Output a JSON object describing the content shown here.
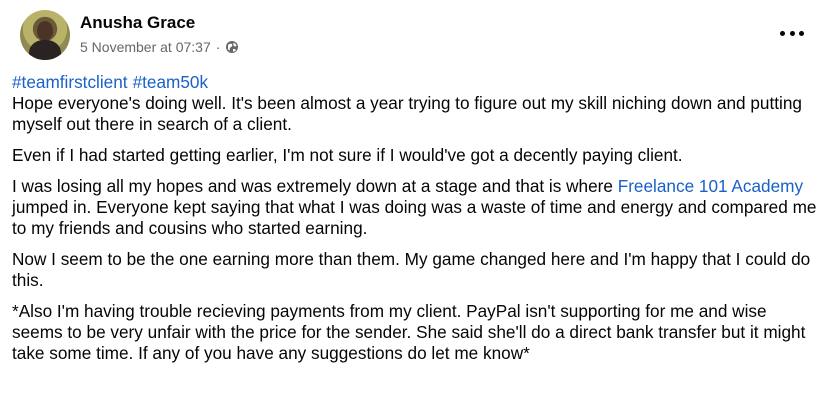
{
  "author": {
    "name": "Anusha Grace",
    "timestamp": "5 November at 07:37",
    "separator": "·",
    "privacy_icon": "globe-icon"
  },
  "menu_icon": "more-options-icon",
  "hashtags": [
    "#teamfirstclient",
    "#team50k"
  ],
  "paragraphs": {
    "p1": "Hope everyone's doing well. It's been almost a year trying to figure out my skill niching down and putting myself out there in search of a client.",
    "p2": "Even if I had started getting earlier, I'm not sure if I would've got a decently paying client.",
    "p3_before": "I was losing all my hopes and was extremely down at a stage and that is where ",
    "p3_link": "Freelance 101 Academy",
    "p3_after": "  jumped in. Everyone kept saying that what I was doing was a waste of time and energy and compared me to my friends and cousins who started earning.",
    "p4": "Now I seem to be the one earning more than them. My game changed here and I'm happy that I could do this.",
    "p5": "*Also I'm having trouble recieving payments from my client. PayPal isn't supporting for me and wise seems to be very unfair with the price for the sender. She said she'll do a direct bank transfer but it might take some time. If any of you have any suggestions do let me know*"
  },
  "colors": {
    "link": "#1a61c7",
    "meta": "#65676b",
    "text": "#050505"
  }
}
